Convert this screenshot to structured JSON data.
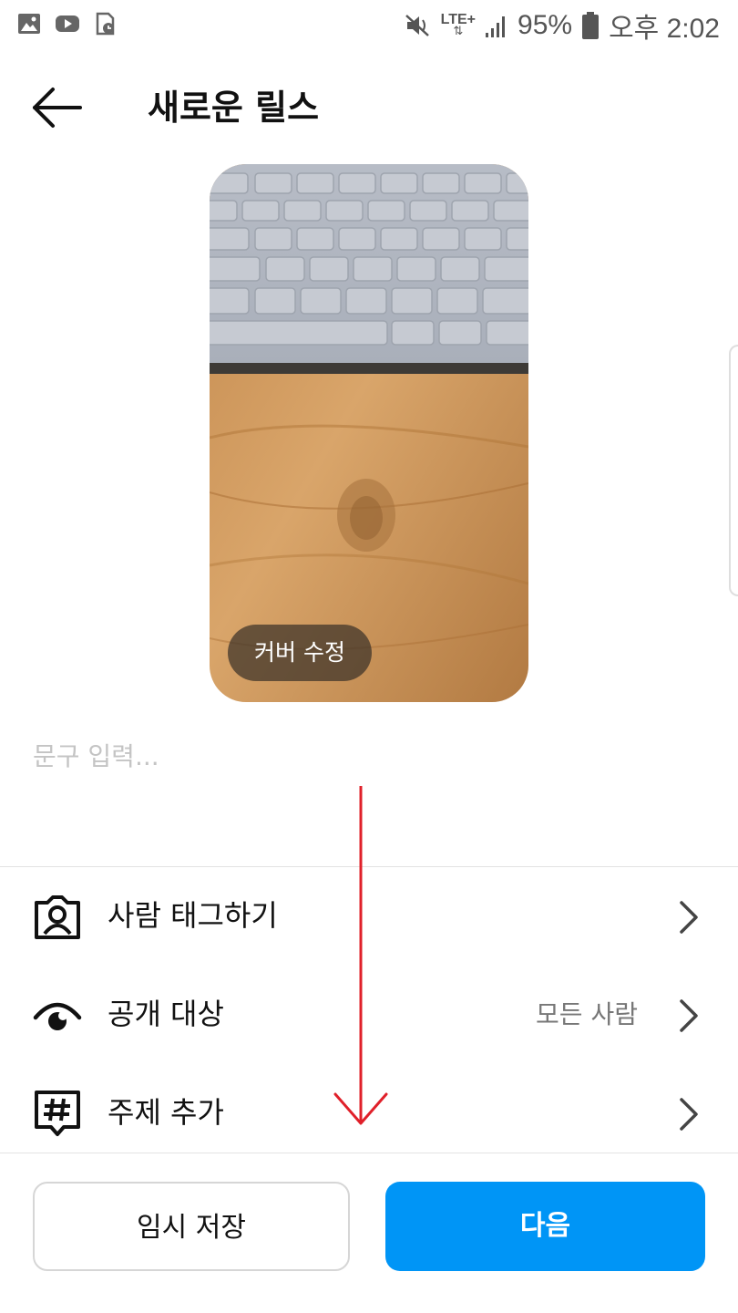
{
  "status_bar": {
    "battery": "95%",
    "time": "오후 2:02",
    "network": "LTE+",
    "left_icons": [
      "gallery-icon",
      "youtube-icon",
      "file-clock-icon"
    ],
    "right_icons": [
      "mute-icon",
      "signal-icon",
      "battery-icon"
    ]
  },
  "header": {
    "title": "새로운 릴스",
    "back_icon": "arrow-left-icon"
  },
  "cover": {
    "edit_label": "커버 수정"
  },
  "caption": {
    "placeholder": "문구 입력...",
    "value": ""
  },
  "options": [
    {
      "icon": "tag-people-icon",
      "label": "사람 태그하기",
      "value": ""
    },
    {
      "icon": "audience-eye-icon",
      "label": "공개 대상",
      "value": "모든 사람"
    },
    {
      "icon": "hashtag-icon",
      "label": "주제 추가",
      "value": ""
    }
  ],
  "buttons": {
    "draft": "임시 저장",
    "next": "다음"
  },
  "colors": {
    "primary": "#0095f6",
    "annotation_arrow": "#e0202a",
    "divider": "#e3e3e3",
    "muted_text": "#777777"
  }
}
